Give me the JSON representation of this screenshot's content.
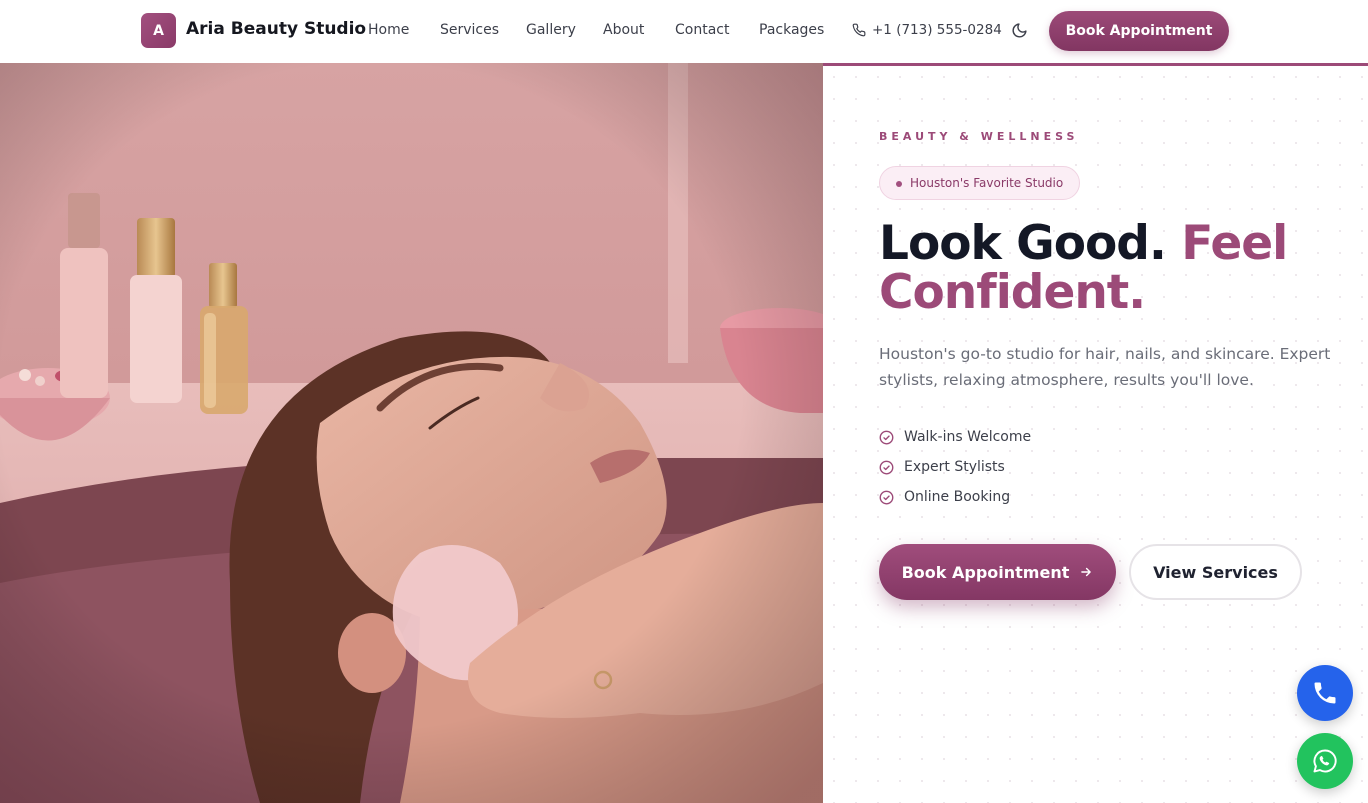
{
  "header": {
    "logo_letter": "A",
    "brand_name": "Aria Beauty Studio",
    "nav": [
      "Home",
      "Services",
      "Gallery",
      "About",
      "Contact",
      "Packages"
    ],
    "phone": "+1 (713) 555-0284",
    "cta_label": "Book Appointment"
  },
  "hero": {
    "eyebrow": "BEAUTY & WELLNESS",
    "chip": "Houston's Favorite Studio",
    "headline_part1": "Look Good.",
    "headline_accent": "Feel Confident.",
    "subtitle": "Houston's go-to studio for hair, nails, and skincare. Expert stylists, relaxing atmosphere, results you'll love.",
    "features": [
      "Walk-ins Welcome",
      "Expert Stylists",
      "Online Booking"
    ],
    "primary_button": "Book Appointment",
    "secondary_button": "View Services"
  },
  "icons": {
    "phone": "phone-icon",
    "theme_toggle": "moon-icon",
    "feature_check": "check-circle-icon",
    "arrow": "arrow-right-icon",
    "call_fab": "phone-icon",
    "whatsapp_fab": "whatsapp-icon"
  },
  "colors": {
    "brand": "#9c4a78",
    "brand_dark": "#823662",
    "chip_bg": "#fbeef5",
    "call_fab": "#2563eb",
    "whatsapp_fab": "#22c35e"
  }
}
